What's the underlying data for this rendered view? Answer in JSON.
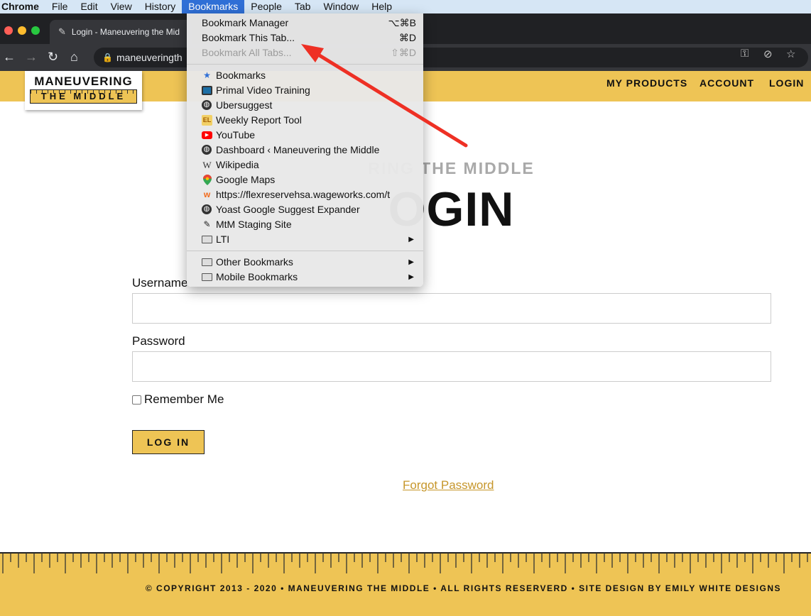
{
  "menubar": {
    "app": "Chrome",
    "items": [
      "File",
      "Edit",
      "View",
      "History",
      "Bookmarks",
      "People",
      "Tab",
      "Window",
      "Help"
    ],
    "active": "Bookmarks"
  },
  "tab": {
    "title": "Login - Maneuvering the Mid"
  },
  "omnibox": {
    "url": "maneuveringth"
  },
  "bookmarks_menu": {
    "top": [
      {
        "label": "Bookmark Manager",
        "shortcut": "⌥⌘B",
        "enabled": true
      },
      {
        "label": "Bookmark This Tab...",
        "shortcut": "⌘D",
        "enabled": true
      },
      {
        "label": "Bookmark All Tabs...",
        "shortcut": "⇧⌘D",
        "enabled": false
      }
    ],
    "bookmarks": [
      {
        "label": "Bookmarks",
        "icon": "star-icon"
      },
      {
        "label": "Primal Video Training",
        "icon": "video-icon"
      },
      {
        "label": "Ubersuggest",
        "icon": "globe-icon"
      },
      {
        "label": "Weekly Report Tool",
        "icon": "el-icon",
        "icon_text": "EL"
      },
      {
        "label": "YouTube",
        "icon": "youtube-icon"
      },
      {
        "label": "Dashboard ‹ Maneuvering the Middle",
        "icon": "globe-icon"
      },
      {
        "label": "Wikipedia",
        "icon": "wikipedia-icon",
        "icon_text": "W"
      },
      {
        "label": "Google Maps",
        "icon": "map-pin-icon"
      },
      {
        "label": "https://flexreservehsa.wageworks.com/t",
        "icon": "wageworks-icon"
      },
      {
        "label": "Yoast Google Suggest Expander",
        "icon": "globe-icon"
      },
      {
        "label": "MtM Staging Site",
        "icon": "pencil-icon"
      },
      {
        "label": "LTI",
        "icon": "folder-icon",
        "submenu": true
      }
    ],
    "folders": [
      {
        "label": "Other Bookmarks",
        "icon": "folder-icon",
        "submenu": true
      },
      {
        "label": "Mobile Bookmarks",
        "icon": "folder-icon",
        "submenu": true
      }
    ]
  },
  "site": {
    "logo_line1": "MANEUVERING",
    "logo_line2": "THE MIDDLE",
    "nav": [
      "MY PRODUCTS",
      "ACCOUNT",
      "LOGIN"
    ],
    "kicker": "RING THE MIDDLE",
    "heading": "OGIN",
    "username_label": "Username",
    "password_label": "Password",
    "remember_label": "Remember Me",
    "login_button": "LOG IN",
    "forgot": "Forgot Password",
    "copyright": "© COPYRIGHT 2013 - 2020  •  MANEUVERING THE MIDDLE  •  ALL RIGHTS RESERVERD  •  SITE DESIGN BY EMILY WHITE DESIGNS"
  },
  "colors": {
    "accent": "#eec455",
    "menu_highlight": "#2f6fd6",
    "arrow": "#ee3024",
    "link": "#c6962a"
  }
}
